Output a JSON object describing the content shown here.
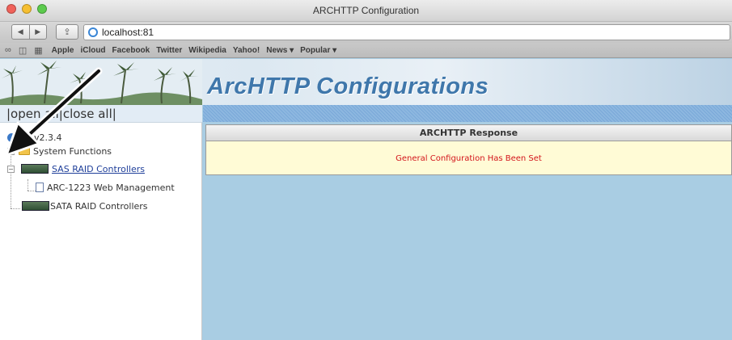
{
  "window": {
    "title": "ARCHTTP Configuration"
  },
  "toolbar": {
    "url": "localhost:81",
    "back_icon": "back-arrow-icon",
    "forward_icon": "forward-arrow-icon"
  },
  "bookmarks": [
    "Apple",
    "iCloud",
    "Facebook",
    "Twitter",
    "Wikipedia",
    "Yahoo!",
    "News ▾",
    "Popular ▾"
  ],
  "header": {
    "title": "ArcHTTP Configurations"
  },
  "sidebar": {
    "open_close": "|open all|close all|",
    "version": "v2.3.4",
    "items": [
      {
        "label": "System Functions"
      },
      {
        "label": "SAS RAID Controllers"
      },
      {
        "label": "ARC-1223 Web Management"
      },
      {
        "label": "SATA RAID Controllers"
      }
    ]
  },
  "main": {
    "response_header": "ARCHTTP Response",
    "response_message": "General Configuration Has Been Set"
  },
  "colors": {
    "accent_title": "#3f77ab",
    "message_red": "#d3141a",
    "content_bg": "#a9cde3",
    "response_bg": "#fffbd6"
  }
}
